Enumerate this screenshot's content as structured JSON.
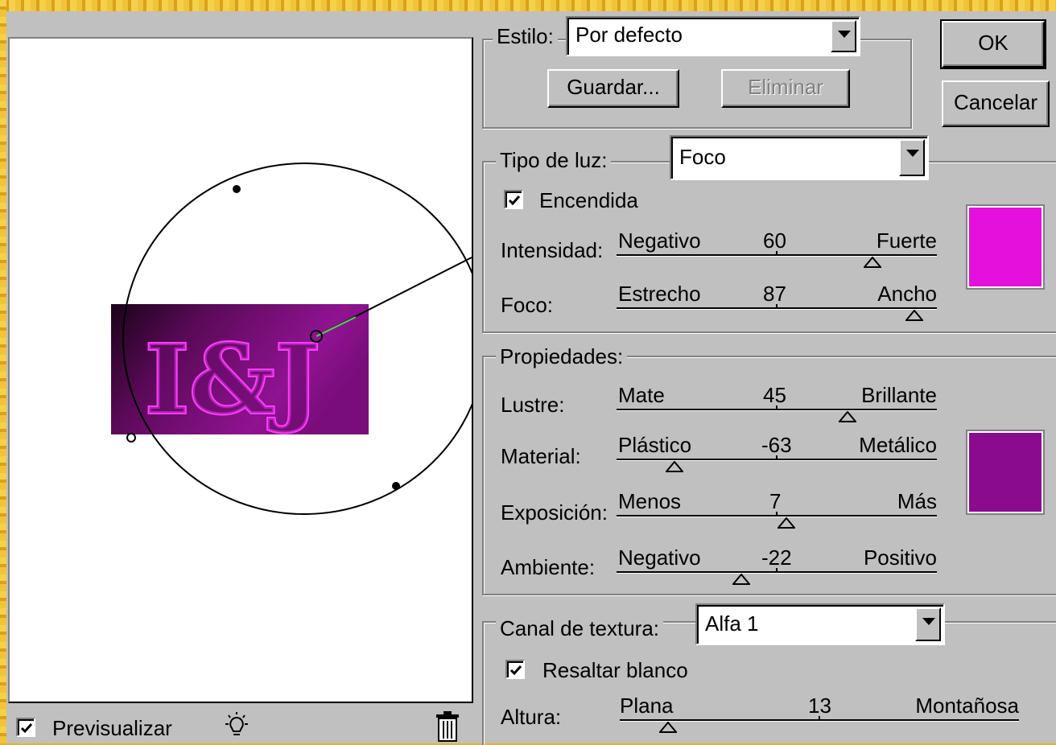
{
  "preview": {
    "label": "Previsualizar",
    "checked": true,
    "image_text": "I&J",
    "light_icon": "lightbulb-icon",
    "trash_icon": "trash-icon"
  },
  "style": {
    "label": "Estilo:",
    "value": "Por defecto",
    "save": "Guardar...",
    "delete": "Eliminar"
  },
  "buttons": {
    "ok": "OK",
    "cancel": "Cancelar"
  },
  "light": {
    "type_label": "Tipo de luz:",
    "type_value": "Foco",
    "on_label": "Encendida",
    "on_checked": true,
    "color": "#e510dc",
    "intensity": {
      "label": "Intensidad:",
      "min": "Negativo",
      "max": "Fuerte",
      "value": "60",
      "pos": 0.8
    },
    "focus": {
      "label": "Foco:",
      "min": "Estrecho",
      "max": "Ancho",
      "value": "87",
      "pos": 0.93
    }
  },
  "properties": {
    "title": "Propiedades:",
    "color": "#8b0b8f",
    "gloss": {
      "label": "Lustre:",
      "min": "Mate",
      "max": "Brillante",
      "value": "45",
      "pos": 0.72
    },
    "material": {
      "label": "Material:",
      "min": "Plástico",
      "max": "Metálico",
      "value": "-63",
      "pos": 0.18
    },
    "exposure": {
      "label": "Exposición:",
      "min": "Menos",
      "max": "Más",
      "value": "7",
      "pos": 0.53
    },
    "ambience": {
      "label": "Ambiente:",
      "min": "Negativo",
      "max": "Positivo",
      "value": "-22",
      "pos": 0.39
    }
  },
  "texture": {
    "label": "Canal de textura:",
    "value": "Alfa 1",
    "white_label": "Resaltar blanco",
    "white_checked": true,
    "height": {
      "label": "Altura:",
      "min": "Plana",
      "max": "Montañosa",
      "value": "13",
      "pos": 0.12
    }
  }
}
